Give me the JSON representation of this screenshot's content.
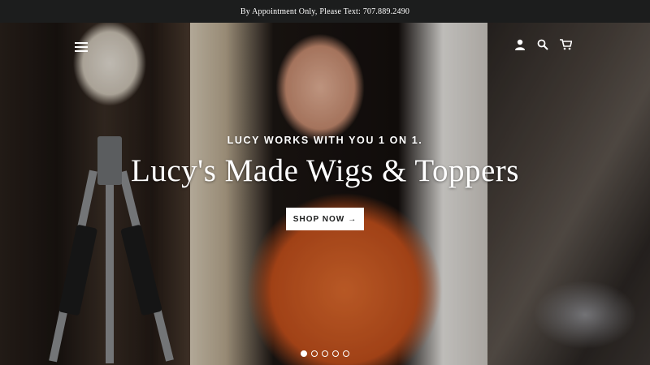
{
  "announcement": {
    "text": "By Appointment Only, Please Text: 707.889.2490"
  },
  "header": {
    "icons": [
      "menu-icon",
      "account-icon",
      "search-icon",
      "cart-icon"
    ]
  },
  "hero": {
    "kicker": "LUCY WORKS WITH YOU 1 ON 1.",
    "title": "Lucy's Made Wigs & Toppers",
    "button_label": "SHOP NOW",
    "button_arrow": "→",
    "slide_count": 5,
    "active_slide": 1
  },
  "colors": {
    "bar_bg": "#1c1d1d",
    "button_bg": "#ffffff",
    "text_light": "#ffffff"
  }
}
